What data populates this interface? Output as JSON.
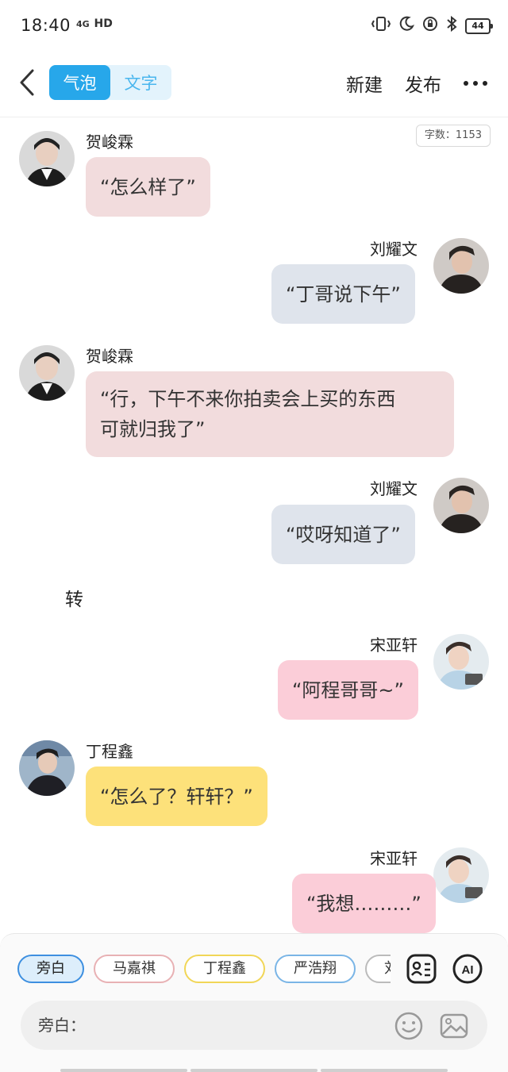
{
  "status_bar": {
    "time": "18:40",
    "network": "4G",
    "hd": "HD",
    "battery": "44"
  },
  "header": {
    "tabs": [
      {
        "label": "气泡",
        "active": true
      },
      {
        "label": "文字",
        "active": false
      }
    ],
    "new_label": "新建",
    "publish_label": "发布"
  },
  "word_count": "字数：1153",
  "messages": [
    {
      "speaker": "贺峻霖",
      "side": "left",
      "text": "“怎么样了”",
      "bubble_color": "#f2dcdd",
      "avatar": "avatar-he"
    },
    {
      "speaker": "刘耀文",
      "side": "right",
      "text": "“丁哥说下午”",
      "bubble_color": "#dfe4ec",
      "avatar": "avatar-liu"
    },
    {
      "speaker": "贺峻霖",
      "side": "left",
      "text_lines": [
        "“行，下午不来你拍卖会上买的东西",
        "可就归我了”"
      ],
      "bubble_color": "#f2dcdd",
      "avatar": "avatar-he"
    },
    {
      "speaker": "刘耀文",
      "side": "right",
      "text": "“哎呀知道了”",
      "bubble_color": "#dfe4ec",
      "avatar": "avatar-liu"
    },
    {
      "narration": "转"
    },
    {
      "speaker": "宋亚轩",
      "side": "right",
      "text": "“阿程哥哥~”",
      "bubble_color": "#fbcdd8",
      "avatar": "avatar-song"
    },
    {
      "speaker": "丁程鑫",
      "side": "left",
      "text": "“怎么了？轩轩？”",
      "bubble_color": "#fde17a",
      "avatar": "avatar-ding"
    },
    {
      "speaker": "宋亚轩",
      "side": "right",
      "text": "“我想………”",
      "bubble_color": "#fbcdd8",
      "avatar": "avatar-song"
    }
  ],
  "roles": [
    "旁白",
    "马嘉祺",
    "丁程鑫",
    "严浩翔",
    "刘耀"
  ],
  "composer": {
    "placeholder": "旁白："
  },
  "colors": {
    "accent": "#27a7ea",
    "he_bubble": "#f2dcdd",
    "liu_bubble": "#dfe4ec",
    "song_bubble": "#fbcdd8",
    "ding_bubble": "#fde17a"
  }
}
